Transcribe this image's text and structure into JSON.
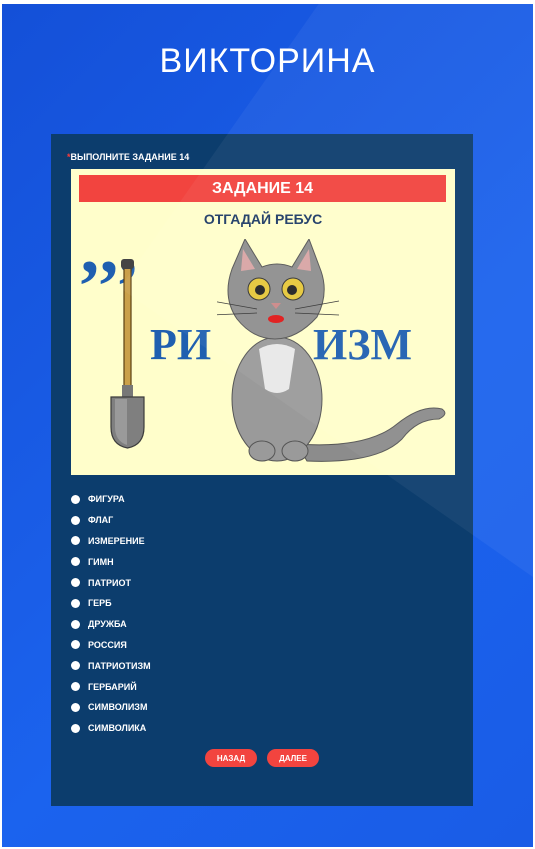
{
  "page": {
    "title": "ВИКТОРИНА"
  },
  "question": {
    "required_mark": "*",
    "label": "ВЫПОЛНИТЕ ЗАДАНИЕ 14"
  },
  "puzzle": {
    "header": "ЗАДАНИЕ 14",
    "subtitle": "ОТГАДАЙ РЕБУС",
    "commas": "’’’",
    "part_a": "РИ",
    "part_b": "ИЗМ",
    "images": [
      "shovel",
      "cat"
    ]
  },
  "options": [
    "ФИГУРА",
    "ФЛАГ",
    "ИЗМЕРЕНИЕ",
    "ГИМН",
    "ПАТРИОТ",
    "ГЕРБ",
    "ДРУЖБА",
    "РОССИЯ",
    "ПАТРИОТИЗМ",
    "ГЕРБАРИЙ",
    "СИМВОЛИЗМ",
    "СИМВОЛИКА"
  ],
  "nav": {
    "back": "НАЗАД",
    "next": "ДАЛЕЕ"
  },
  "colors": {
    "background": "#1a5ae4",
    "card": "#0c3d6d",
    "puzzle_bg": "#fffecb",
    "accent": "#f2443f",
    "rebus_text": "#1f5fb0"
  }
}
